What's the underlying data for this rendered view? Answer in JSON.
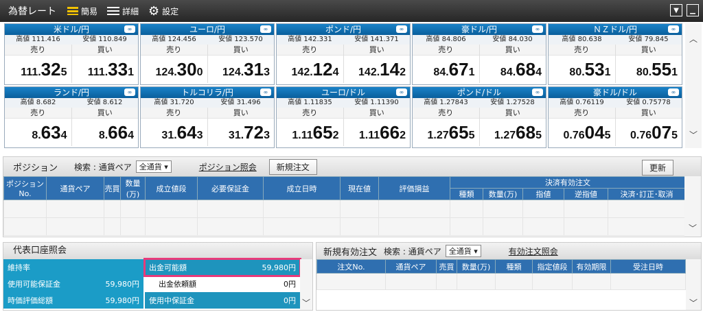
{
  "topbar": {
    "title": "為替レート",
    "simple_label": "簡易",
    "detail_label": "詳細",
    "settings_label": "設定"
  },
  "pairs": [
    {
      "name": "米ドル/円",
      "high": "高値 111.416",
      "low": "安値 110.849",
      "sell_label": "売り",
      "buy_label": "買い",
      "sell": {
        "a": "111.",
        "b": "32",
        "c": "5"
      },
      "buy": {
        "a": "111.",
        "b": "33",
        "c": "1"
      }
    },
    {
      "name": "ユーロ/円",
      "high": "高値 124.456",
      "low": "安値 123.570",
      "sell_label": "売り",
      "buy_label": "買い",
      "sell": {
        "a": "124.",
        "b": "30",
        "c": "0"
      },
      "buy": {
        "a": "124.",
        "b": "31",
        "c": "3"
      }
    },
    {
      "name": "ポンド/円",
      "high": "高値 142.331",
      "low": "安値 141.371",
      "sell_label": "売り",
      "buy_label": "買い",
      "sell": {
        "a": "142.",
        "b": "12",
        "c": "4"
      },
      "buy": {
        "a": "142.",
        "b": "14",
        "c": "2"
      }
    },
    {
      "name": "豪ドル/円",
      "high": "高値 84.806",
      "low": "安値 84.030",
      "sell_label": "売り",
      "buy_label": "買い",
      "sell": {
        "a": "84.",
        "b": "67",
        "c": "1"
      },
      "buy": {
        "a": "84.",
        "b": "68",
        "c": "4"
      }
    },
    {
      "name": "ＮＺドル/円",
      "high": "高値 80.638",
      "low": "安値 79.845",
      "sell_label": "売り",
      "buy_label": "買い",
      "sell": {
        "a": "80.",
        "b": "53",
        "c": "1"
      },
      "buy": {
        "a": "80.",
        "b": "55",
        "c": "1"
      }
    },
    {
      "name": "ランド/円",
      "high": "高値 8.682",
      "low": "安値 8.612",
      "sell_label": "売り",
      "buy_label": "買い",
      "sell": {
        "a": "8.",
        "b": "63",
        "c": "4"
      },
      "buy": {
        "a": "8.",
        "b": "66",
        "c": "4"
      }
    },
    {
      "name": "トルコリラ/円",
      "high": "高値 31.720",
      "low": "安値 31.496",
      "sell_label": "売り",
      "buy_label": "買い",
      "sell": {
        "a": "31.",
        "b": "64",
        "c": "3"
      },
      "buy": {
        "a": "31.",
        "b": "72",
        "c": "3"
      }
    },
    {
      "name": "ユーロ/ドル",
      "high": "高値 1.11835",
      "low": "安値 1.11390",
      "sell_label": "売り",
      "buy_label": "買い",
      "sell": {
        "a": "1.11",
        "b": "65",
        "c": "2"
      },
      "buy": {
        "a": "1.11",
        "b": "66",
        "c": "2"
      }
    },
    {
      "name": "ポンド/ドル",
      "high": "高値 1.27843",
      "low": "安値 1.27528",
      "sell_label": "売り",
      "buy_label": "買い",
      "sell": {
        "a": "1.27",
        "b": "65",
        "c": "5"
      },
      "buy": {
        "a": "1.27",
        "b": "68",
        "c": "5"
      }
    },
    {
      "name": "豪ドル/ドル",
      "high": "高値 0.76119",
      "low": "安値 0.75778",
      "sell_label": "売り",
      "buy_label": "買い",
      "sell": {
        "a": "0.76",
        "b": "04",
        "c": "5"
      },
      "buy": {
        "a": "0.76",
        "b": "07",
        "c": "5"
      }
    }
  ],
  "position": {
    "title": "ポジション",
    "search_label": "検索 : 通貨ペア",
    "select_value": "全通貨",
    "inquiry_link": "ポジション照会",
    "new_order_button": "新規注文",
    "refresh_button": "更新",
    "columns": [
      "ポジションNo.",
      "通貨ペア",
      "売買",
      "数量(万)",
      "成立値段",
      "必要保証金",
      "成立日時",
      "現在値",
      "評価損益",
      "決済有効注文"
    ],
    "sub_columns": [
      "種類",
      "数量(万)",
      "指値",
      "逆指値",
      "決済･訂正･取消"
    ]
  },
  "account": {
    "title": "代表口座照会",
    "left_rows": [
      {
        "label": "維持率",
        "value": ""
      },
      {
        "label": "使用可能保証金",
        "value": "59,980円"
      },
      {
        "label": "時価評価総額",
        "value": "59,980円"
      }
    ],
    "right_rows": [
      {
        "label": "出金可能額",
        "value": "59,980円"
      },
      {
        "label": "出金依頼額",
        "value": "0円"
      },
      {
        "label": "使用中保証金",
        "value": "0円"
      }
    ]
  },
  "orders": {
    "title": "新規有効注文",
    "search_label": "検索 : 通貨ペア",
    "select_value": "全通貨",
    "inquiry_link": "有効注文照会",
    "columns": [
      "注文No.",
      "通貨ペア",
      "売買",
      "数量(万)",
      "種類",
      "指定値段",
      "有効期限",
      "受注日時"
    ]
  }
}
